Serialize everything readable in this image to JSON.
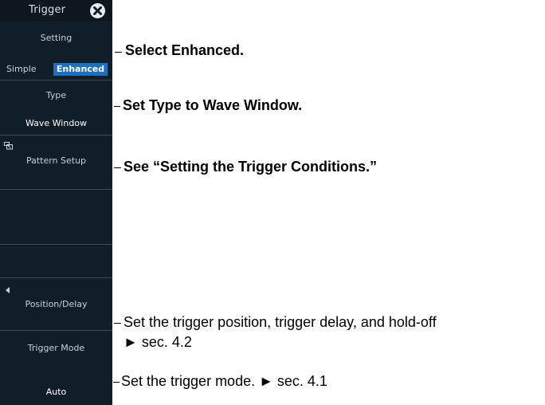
{
  "panel": {
    "title": "Trigger",
    "setting": {
      "label": "Setting",
      "option_simple": "Simple",
      "option_enhanced": "Enhanced",
      "selected": "Enhanced"
    },
    "type": {
      "label": "Type",
      "value": "Wave Window"
    },
    "pattern_setup": {
      "label": "Pattern Setup"
    },
    "position_delay": {
      "label": "Position/Delay"
    },
    "trigger_mode": {
      "label": "Trigger Mode",
      "value": "Auto"
    }
  },
  "callouts": {
    "setting": "Select Enhanced.",
    "type": "Set Type to Wave Window.",
    "pattern": "See “Setting the Trigger Conditions.”",
    "position_line1": "Set the trigger position, trigger delay, and hold-off",
    "position_line2": "► sec. 4.2",
    "mode": "Set the trigger mode. ► sec. 4.1"
  },
  "icons": {
    "close": "close-icon",
    "submenu": "submenu-icon",
    "back_arrow": "triangle-left-icon"
  },
  "colors": {
    "panel_bg": "#0f1e29",
    "selected_bg": "#1d6fc0",
    "text_light": "#c9d0d6"
  }
}
